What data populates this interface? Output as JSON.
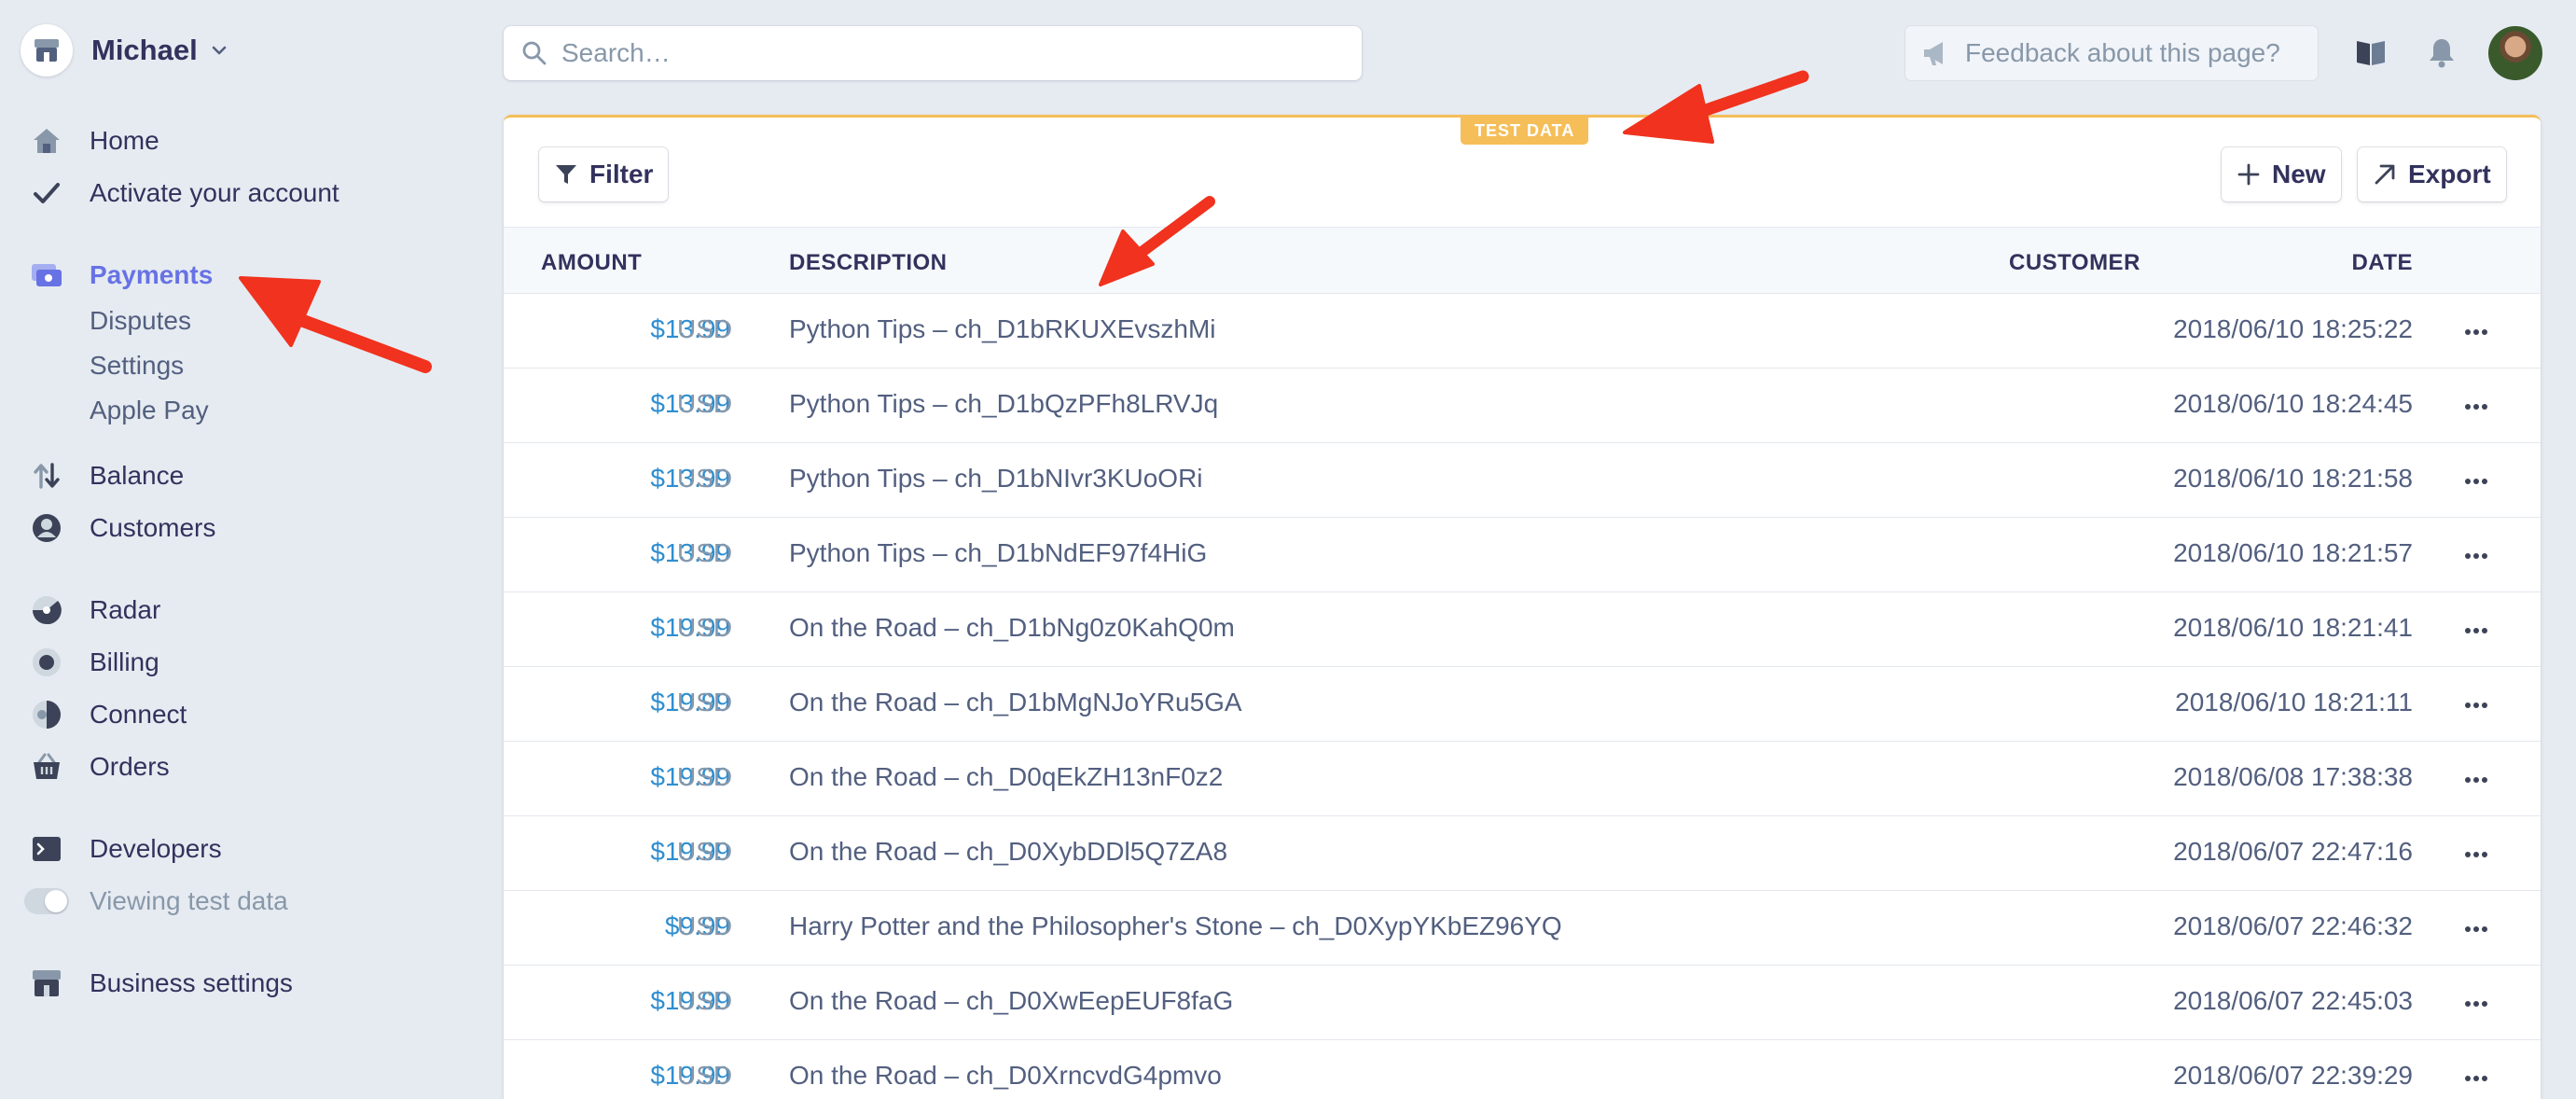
{
  "account": {
    "name": "Michael"
  },
  "nav": {
    "home": "Home",
    "activate": "Activate your account",
    "payments": "Payments",
    "payments_sub": [
      "Disputes",
      "Settings",
      "Apple Pay"
    ],
    "balance": "Balance",
    "customers": "Customers",
    "radar": "Radar",
    "billing": "Billing",
    "connect": "Connect",
    "orders": "Orders",
    "developers": "Developers",
    "test_data": "Viewing test data",
    "business_settings": "Business settings"
  },
  "search": {
    "placeholder": "Search…"
  },
  "feedback": {
    "placeholder": "Feedback about this page?"
  },
  "badge": "TEST DATA",
  "toolbar": {
    "filter": "Filter",
    "new": "New",
    "export": "Export"
  },
  "table": {
    "headers": {
      "amount": "AMOUNT",
      "description": "DESCRIPTION",
      "customer": "CUSTOMER",
      "date": "DATE"
    },
    "rows": [
      {
        "amount": "$13.99",
        "currency": "USD",
        "description": "Python Tips – ch_D1bRKUXEvszhMi",
        "date": "2018/06/10 18:25:22"
      },
      {
        "amount": "$13.99",
        "currency": "USD",
        "description": "Python Tips – ch_D1bQzPFh8LRVJq",
        "date": "2018/06/10 18:24:45"
      },
      {
        "amount": "$13.99",
        "currency": "USD",
        "description": "Python Tips – ch_D1bNIvr3KUoORi",
        "date": "2018/06/10 18:21:58"
      },
      {
        "amount": "$13.99",
        "currency": "USD",
        "description": "Python Tips – ch_D1bNdEF97f4HiG",
        "date": "2018/06/10 18:21:57"
      },
      {
        "amount": "$19.99",
        "currency": "USD",
        "description": "On the Road – ch_D1bNg0z0KahQ0m",
        "date": "2018/06/10 18:21:41"
      },
      {
        "amount": "$19.99",
        "currency": "USD",
        "description": "On the Road – ch_D1bMgNJoYRu5GA",
        "date": "2018/06/10 18:21:11"
      },
      {
        "amount": "$19.99",
        "currency": "USD",
        "description": "On the Road – ch_D0qEkZH13nF0z2",
        "date": "2018/06/08 17:38:38"
      },
      {
        "amount": "$19.99",
        "currency": "USD",
        "description": "On the Road – ch_D0XybDDl5Q7ZA8",
        "date": "2018/06/07 22:47:16"
      },
      {
        "amount": "$9.99",
        "currency": "USD",
        "description": "Harry Potter and the Philosopher's Stone – ch_D0XypYKbEZ96YQ",
        "date": "2018/06/07 22:46:32"
      },
      {
        "amount": "$19.99",
        "currency": "USD",
        "description": "On the Road – ch_D0XwEepEUF8faG",
        "date": "2018/06/07 22:45:03"
      },
      {
        "amount": "$19.99",
        "currency": "USD",
        "description": "On the Road – ch_D0XrncvdG4pmvo",
        "date": "2018/06/07 22:39:29"
      }
    ]
  },
  "colors": {
    "accent": "#6772e5",
    "amount": "#2f8ed0",
    "test_badge": "#f5be58",
    "arrow": "#f0321e",
    "background": "#e6ebf1"
  }
}
